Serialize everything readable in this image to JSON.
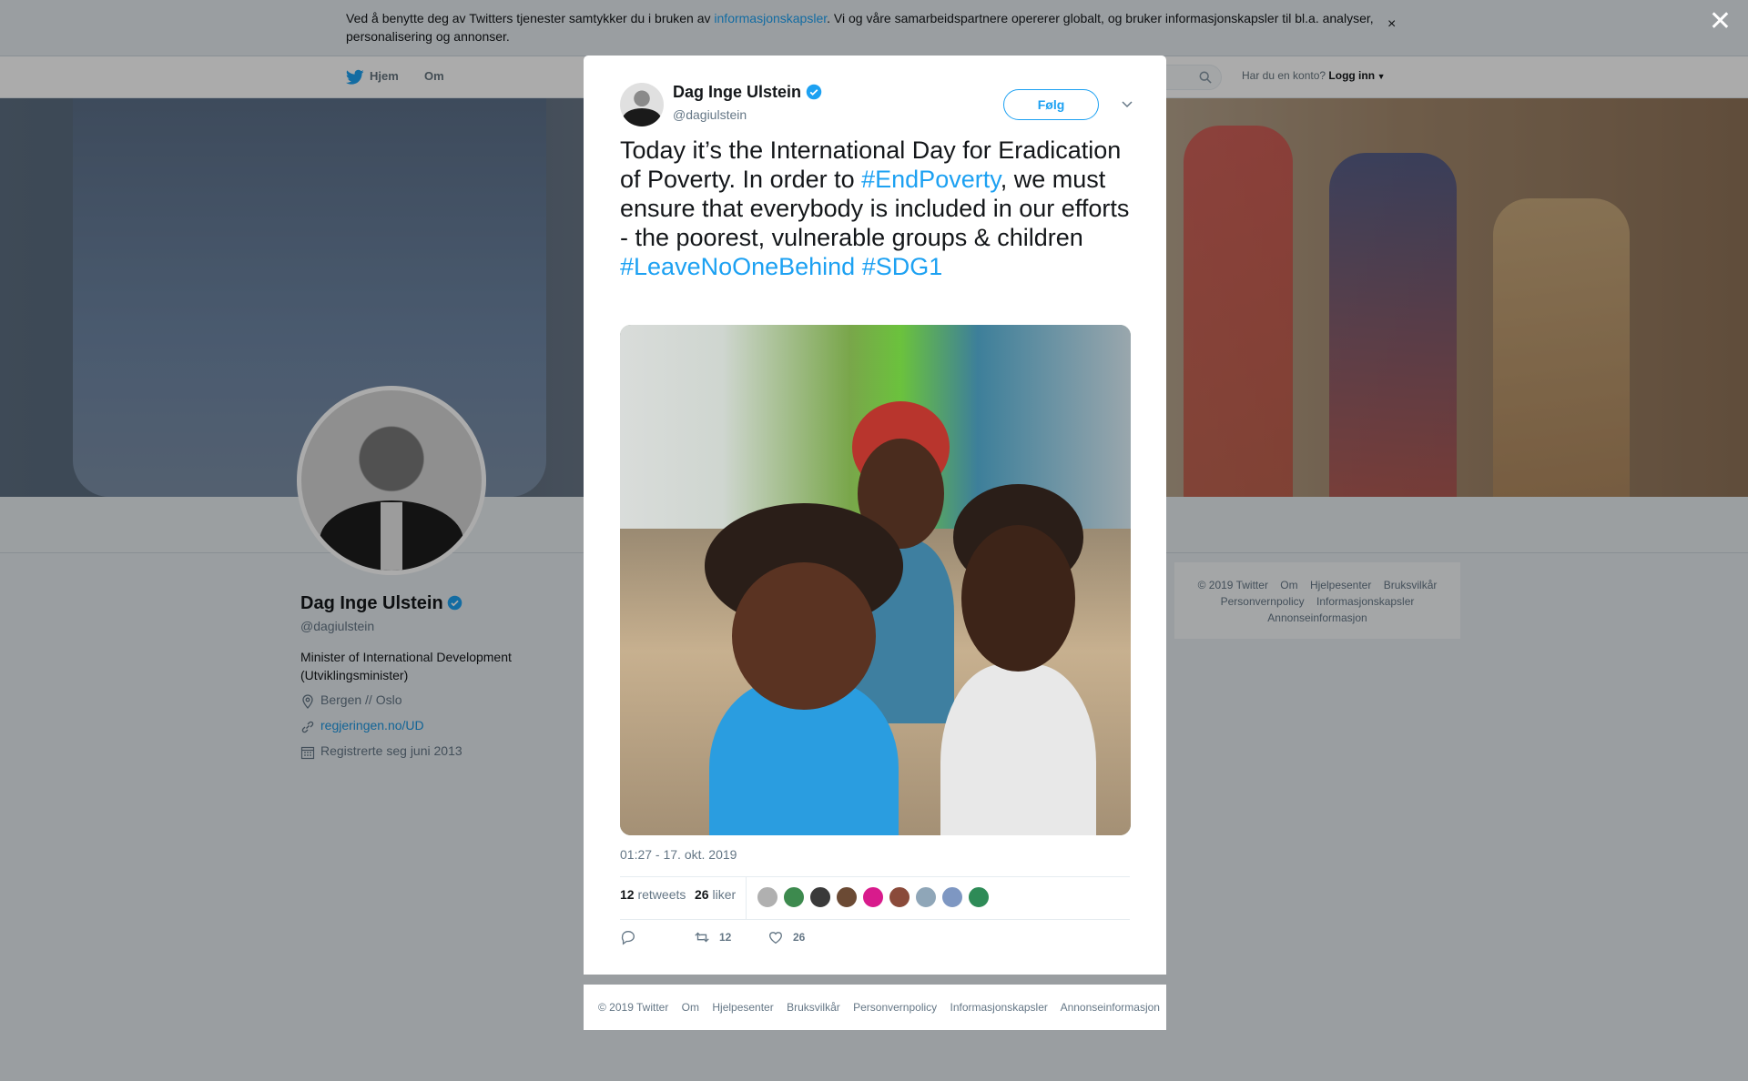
{
  "cookie_banner": {
    "text_before": "Ved å benytte deg av Twitters tjenester samtykker du i bruken av ",
    "link": "informasjonskapsler",
    "text_after": ". Vi og våre samarbeidspartnere opererer globalt, og bruker informasjonskapsler til bl.a. analyser, personalisering og annonser.",
    "close": "×"
  },
  "overlay_close": "✕",
  "nav": {
    "home": "Hjem",
    "about": "Om",
    "account_prompt": "Har du en konto?",
    "login": "Logg inn"
  },
  "profile": {
    "name": "Dag Inge Ulstein",
    "handle": "@dagiulstein",
    "bio": "Minister of International Development (Utviklingsminister)",
    "location": "Bergen // Oslo",
    "website": "regjeringen.no/UD",
    "joined": "Registrerte seg juni 2013"
  },
  "side_footer": {
    "items": [
      "© 2019 Twitter",
      "Om",
      "Hjelpesenter",
      "Bruksvilkår",
      "Personvernpolicy",
      "Informasjonskapsler",
      "Annonseinformasjon"
    ]
  },
  "tweet": {
    "author_name": "Dag Inge Ulstein",
    "author_handle": "@dagiulstein",
    "follow_label": "Følg",
    "text_part1": "Today it’s the International Day for Eradication of Poverty. In order to ",
    "hashtag1": "#EndPoverty",
    "text_part2": ", we must ensure that everybody is included in our efforts - the poorest, vulnerable groups & children ",
    "hashtag2": "#LeaveNoOneBehind",
    "hashtag3": "#SDG1",
    "timestamp": "01:27 - 17. okt. 2019",
    "retweets_count": "12",
    "retweets_label": "retweets",
    "likes_count": "26",
    "likes_label": "liker",
    "action_retweet_count": "12",
    "action_like_count": "26"
  },
  "modal_footer": {
    "items": [
      "© 2019 Twitter",
      "Om",
      "Hjelpesenter",
      "Bruksvilkår",
      "Personvernpolicy",
      "Informasjonskapsler",
      "Annonseinformasjon"
    ]
  },
  "colors": {
    "accent": "#1da1f2",
    "text": "#14171a",
    "muted": "#657786"
  },
  "icons": {
    "brand": "twitter-bird-icon",
    "verified": "verified-badge-icon",
    "search": "search-icon",
    "location": "location-pin-icon",
    "link": "link-icon",
    "calendar": "calendar-icon",
    "reply": "reply-icon",
    "retweet": "retweet-icon",
    "like": "heart-icon",
    "caret": "chevron-down-icon"
  }
}
